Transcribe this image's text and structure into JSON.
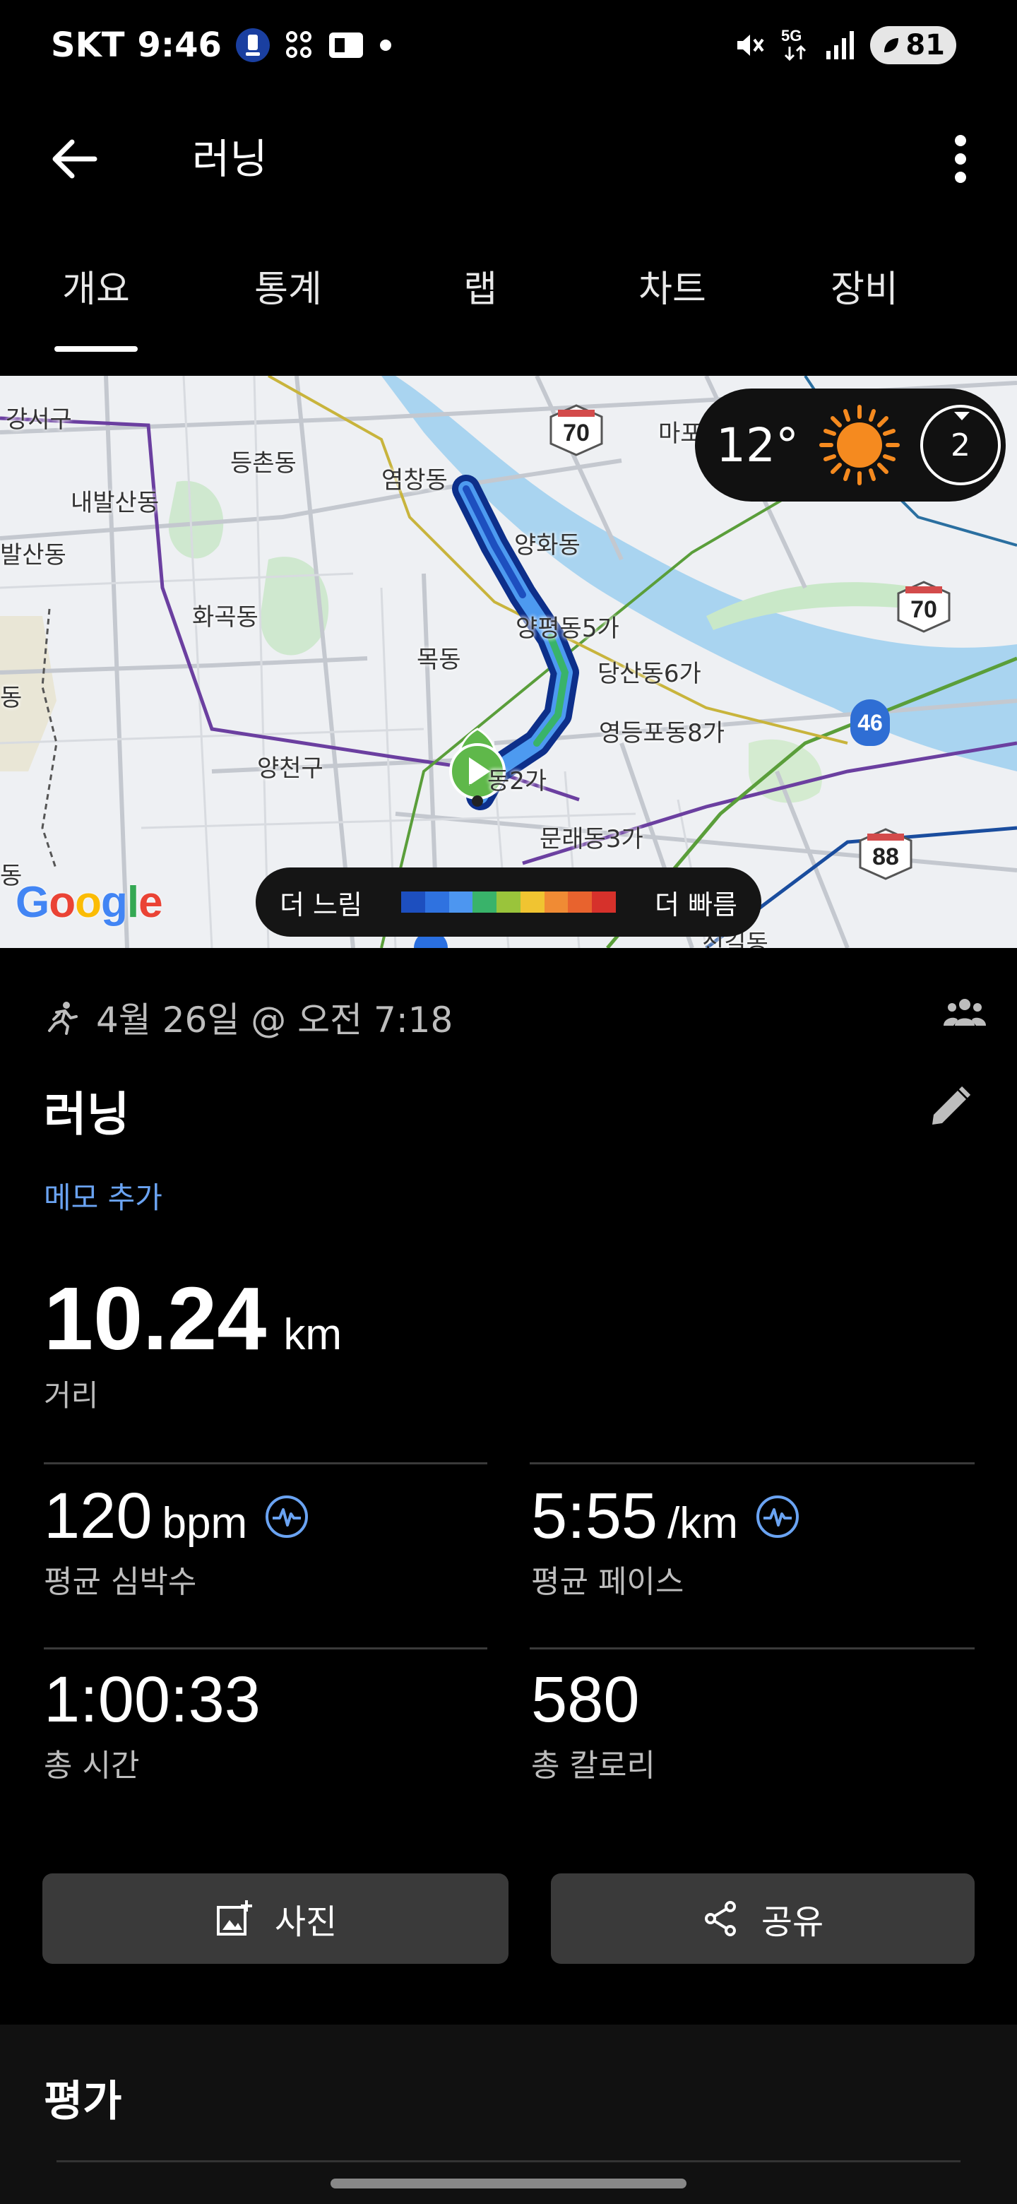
{
  "status_bar": {
    "carrier": "SKT",
    "time": "9:46",
    "network": "5G",
    "battery": "81",
    "icons": [
      "tmap-icon",
      "grid-app-icon",
      "wallet-icon",
      "dot-icon",
      "mute-icon",
      "5g-icon",
      "signal-icon",
      "battery-icon"
    ]
  },
  "app_bar": {
    "title": "러닝",
    "back_icon": "back-arrow-icon",
    "more_icon": "more-vert-icon"
  },
  "tabs": [
    {
      "label": "개요",
      "active": true
    },
    {
      "label": "통계",
      "active": false
    },
    {
      "label": "랩",
      "active": false
    },
    {
      "label": "차트",
      "active": false
    },
    {
      "label": "장비",
      "active": false
    }
  ],
  "map": {
    "labels": [
      "강서구",
      "등촌동",
      "염창동",
      "내발산동",
      "발산동",
      "양화동",
      "화곡동",
      "양평동5가",
      "목동",
      "당산동6가",
      "영등포동8가",
      "양천구",
      "동2가",
      "문래동3가",
      "동",
      "동",
      "마포",
      "신길동"
    ],
    "route_shields": [
      "70",
      "70",
      "88"
    ],
    "route_circle": "46",
    "weather": {
      "temperature": "12°",
      "icon": "sun-icon",
      "uv_index": "2"
    },
    "pace_legend": {
      "slow_label": "더 느림",
      "fast_label": "더 빠름",
      "colors": [
        "#1d4fbf",
        "#2f72e0",
        "#4d96f0",
        "#39b36a",
        "#9ac43b",
        "#f0c431",
        "#f08b34",
        "#e8632e",
        "#d6312b"
      ]
    },
    "attribution": "Google"
  },
  "workout": {
    "date": "4월 26일 @ 오전 7:18",
    "title": "러닝",
    "add_memo": "메모 추가",
    "distance": {
      "value": "10.24",
      "unit": "km",
      "label": "거리"
    },
    "heart_rate": {
      "value": "120",
      "unit": "bpm",
      "label": "평균 심박수"
    },
    "pace": {
      "value": "5:55",
      "unit": "/km",
      "label": "평균 페이스"
    },
    "duration": {
      "value": "1:00:33",
      "label": "총 시간"
    },
    "calories": {
      "value": "580",
      "label": "총 칼로리"
    },
    "photo_button": "사진",
    "share_button": "공유"
  },
  "evaluation": {
    "title": "평가"
  },
  "colors": {
    "accent_blue": "#6aa3f2",
    "route_blue": "#2a6fe0",
    "start_green": "#5fb84a",
    "background": "#000000"
  }
}
